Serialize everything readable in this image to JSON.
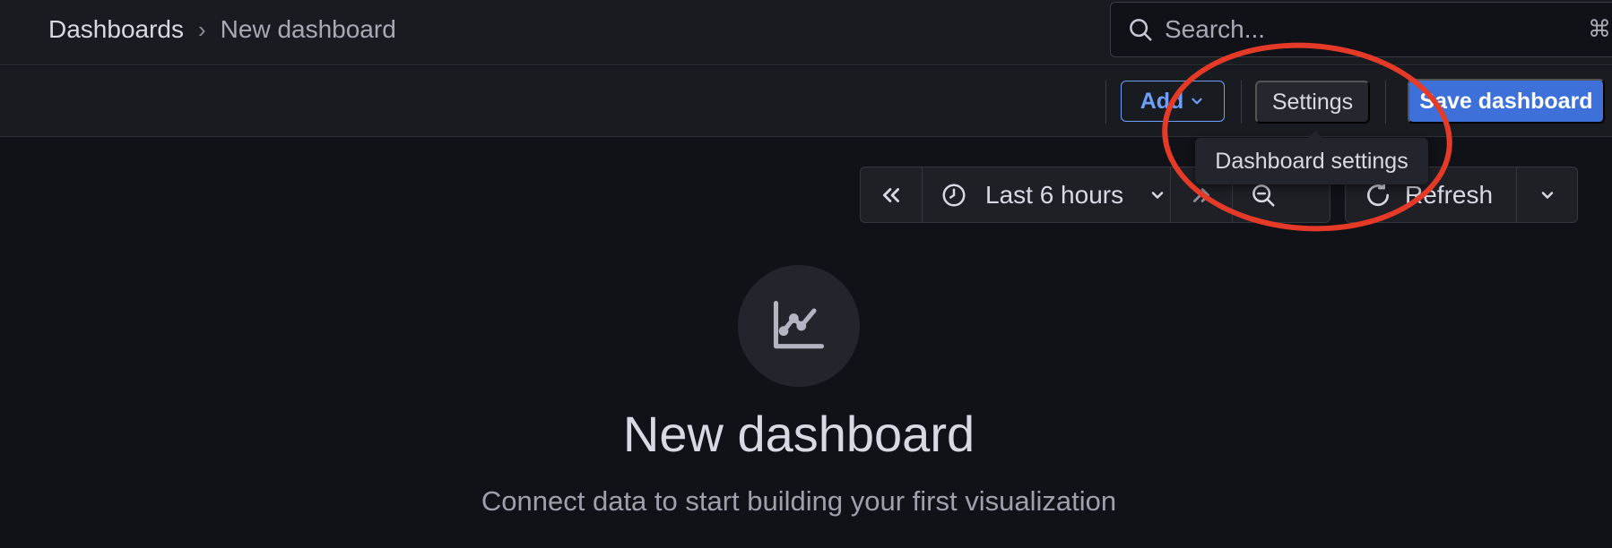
{
  "breadcrumb": {
    "parent": "Dashboards",
    "separator": "›",
    "current": "New dashboard"
  },
  "search": {
    "placeholder": "Search...",
    "shortcut": "⌘"
  },
  "toolbar": {
    "add_label": "Add",
    "settings_label": "Settings",
    "save_label": "Save dashboard"
  },
  "tooltip": {
    "text": "Dashboard settings"
  },
  "timepicker": {
    "range_label": "Last 6 hours",
    "refresh_label": "Refresh"
  },
  "empty_state": {
    "title": "New dashboard",
    "subtitle": "Connect data to start building your first visualization"
  },
  "colors": {
    "background": "#111217",
    "panel": "#181b1f",
    "primary": "#3d71d9",
    "primary_text": "#6e9fff",
    "annotation": "#e53a27"
  }
}
